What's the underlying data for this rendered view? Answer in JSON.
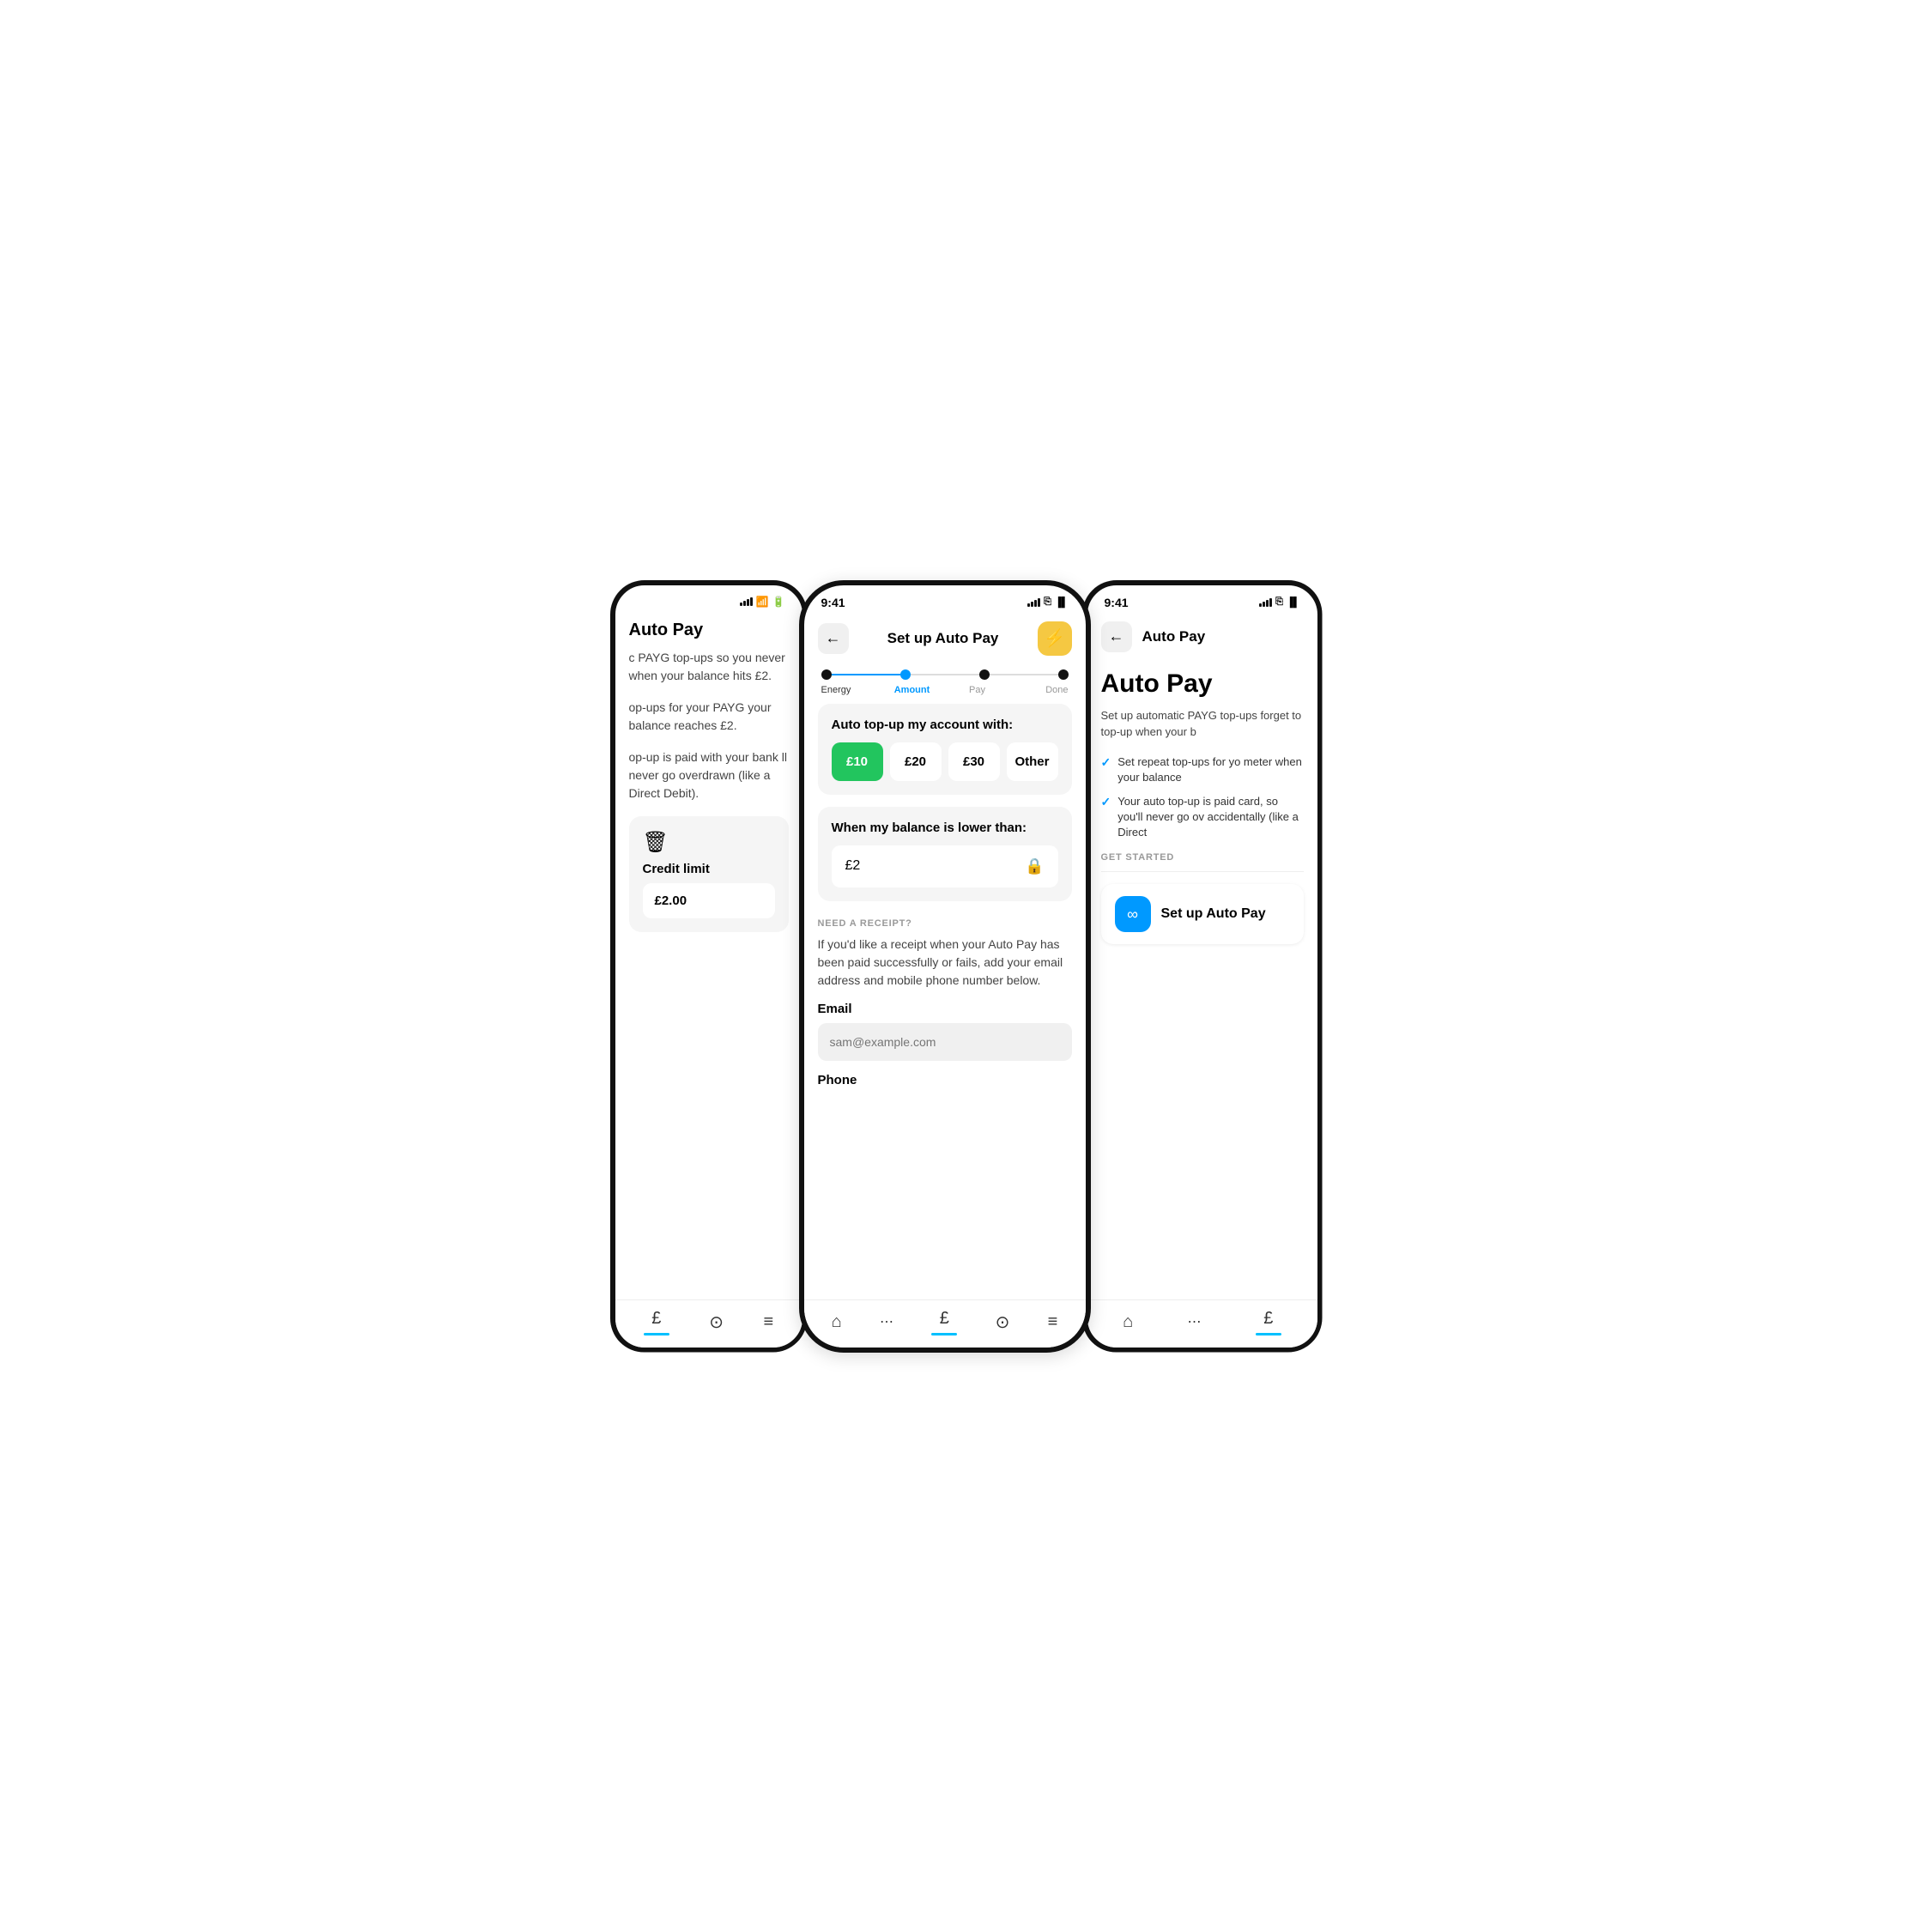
{
  "phones": {
    "left": {
      "statusBar": {
        "time": "",
        "showIcons": true
      },
      "nav": {
        "title": "Auto Pay",
        "backVisible": false
      },
      "body": {
        "description1": "c PAYG top-ups so you never when your balance hits £2.",
        "description2": "op-ups for your PAYG your balance reaches £2.",
        "description3": "op-up is paid with your bank ll never go overdrawn (like a Direct Debit).",
        "creditSection": {
          "label": "Credit limit",
          "value": "£2.00"
        }
      },
      "tabBar": {
        "items": [
          "£",
          "?",
          "≡"
        ]
      }
    },
    "center": {
      "statusBar": {
        "time": "9:41"
      },
      "nav": {
        "backIcon": "←",
        "title": "Set up Auto Pay",
        "actionIcon": "⚡"
      },
      "steps": [
        {
          "label": "Energy",
          "state": "completed"
        },
        {
          "label": "Amount",
          "state": "active"
        },
        {
          "label": "Pay",
          "state": "upcoming"
        },
        {
          "label": "Done",
          "state": "upcoming"
        }
      ],
      "amountCard": {
        "title": "Auto top-up my account with:",
        "options": [
          {
            "value": "£10",
            "selected": true
          },
          {
            "value": "£20",
            "selected": false
          },
          {
            "value": "£30",
            "selected": false
          },
          {
            "value": "Other",
            "selected": false
          }
        ]
      },
      "balanceCard": {
        "title": "When my balance is lower than:",
        "value": "£2"
      },
      "receiptSection": {
        "sectionLabel": "NEED A RECEIPT?",
        "description": "If you'd like a receipt when your Auto Pay has been paid successfully or fails, add your email address and mobile phone number below.",
        "emailLabel": "Email",
        "emailPlaceholder": "sam@example.com",
        "phoneLabel": "Phone"
      },
      "tabBar": {
        "items": [
          "🏠",
          "⋯",
          "£",
          "?",
          "≡"
        ]
      }
    },
    "right": {
      "statusBar": {
        "time": "9:41"
      },
      "nav": {
        "backIcon": "←",
        "title": "Auto Pay"
      },
      "body": {
        "title": "Auto Pay",
        "description": "Set up automatic PAYG top-ups forget to top-up when your b",
        "checkItems": [
          "Set repeat top-ups for yo meter when your balance",
          "Your auto top-up is paid card, so you'll never go ov accidentally (like a Direct"
        ],
        "getStartedLabel": "GET STARTED",
        "setupButton": {
          "label": "Set up Auto Pay",
          "icon": "∞"
        }
      },
      "tabBar": {
        "items": [
          "🏠",
          "⋯",
          "£"
        ]
      }
    }
  },
  "colors": {
    "green": "#22c55e",
    "blue": "#0099ff",
    "yellow": "#f5c842",
    "lightGray": "#f5f5f5",
    "tabIndicator": "#00c0ff",
    "darkDot": "#111111",
    "blueDot": "#0099ff",
    "grayLine": "#dddddd"
  }
}
